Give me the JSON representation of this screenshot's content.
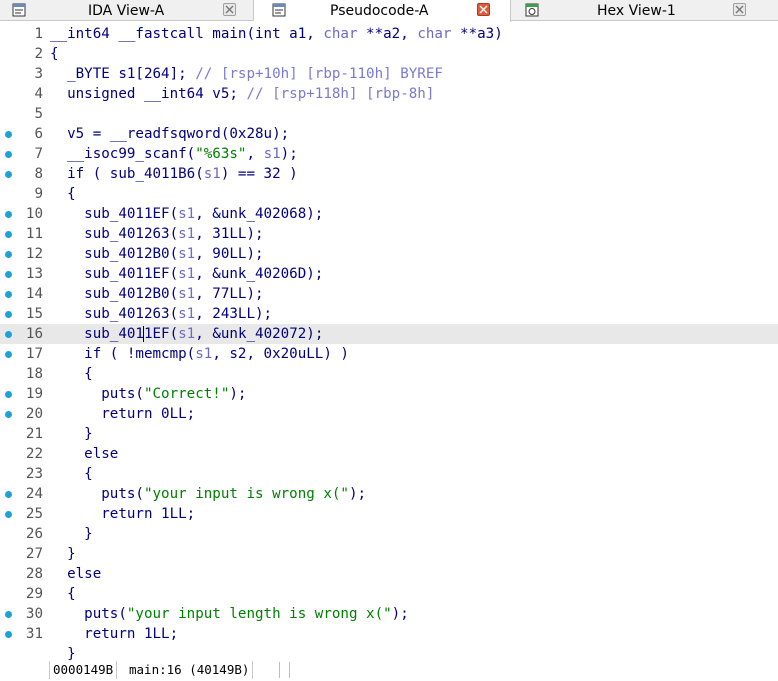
{
  "tabs": [
    {
      "label": "IDA View-A",
      "icon": "ida-view-icon",
      "active": false
    },
    {
      "label": "Pseudocode-A",
      "icon": "pseudocode-icon",
      "active": true
    },
    {
      "label": "Hex View-1",
      "icon": "hex-view-icon",
      "active": false
    }
  ],
  "code": {
    "lines": [
      {
        "n": "1",
        "bp": false,
        "t": [
          [
            "kw",
            "__int64 __fastcall main(int a1, "
          ],
          [
            "var",
            "char"
          ],
          [
            "kw",
            " **a2, "
          ],
          [
            "var",
            "char"
          ],
          [
            "kw",
            " **a3)"
          ]
        ]
      },
      {
        "n": "2",
        "bp": false,
        "t": [
          [
            "kw",
            "{"
          ]
        ]
      },
      {
        "n": "3",
        "bp": false,
        "t": [
          [
            "kw",
            "  _BYTE s1[264]; "
          ],
          [
            "cmt",
            "// [rsp+10h] [rbp-110h] BYREF"
          ]
        ]
      },
      {
        "n": "4",
        "bp": false,
        "t": [
          [
            "kw",
            "  unsigned __int64 v5; "
          ],
          [
            "cmt",
            "// [rsp+118h] [rbp-8h]"
          ]
        ]
      },
      {
        "n": "5",
        "bp": false,
        "t": [
          [
            "kw",
            ""
          ]
        ]
      },
      {
        "n": "6",
        "bp": true,
        "t": [
          [
            "kw",
            "  v5 = __readfsqword(0x28u);"
          ]
        ]
      },
      {
        "n": "7",
        "bp": true,
        "t": [
          [
            "kw",
            "  __isoc99_scanf("
          ],
          [
            "str",
            "\"%63s\""
          ],
          [
            "kw",
            ", "
          ],
          [
            "var",
            "s1"
          ],
          [
            "kw",
            ");"
          ]
        ]
      },
      {
        "n": "8",
        "bp": true,
        "t": [
          [
            "kw",
            "  if ( sub_4011B6("
          ],
          [
            "var",
            "s1"
          ],
          [
            "kw",
            ") == 32 )"
          ]
        ]
      },
      {
        "n": "9",
        "bp": false,
        "t": [
          [
            "kw",
            "  {"
          ]
        ]
      },
      {
        "n": "10",
        "bp": true,
        "t": [
          [
            "kw",
            "    sub_4011EF("
          ],
          [
            "var",
            "s1"
          ],
          [
            "kw",
            ", &unk_402068);"
          ]
        ]
      },
      {
        "n": "11",
        "bp": true,
        "t": [
          [
            "kw",
            "    sub_401263("
          ],
          [
            "var",
            "s1"
          ],
          [
            "kw",
            ", 31LL);"
          ]
        ]
      },
      {
        "n": "12",
        "bp": true,
        "t": [
          [
            "kw",
            "    sub_4012B0("
          ],
          [
            "var",
            "s1"
          ],
          [
            "kw",
            ", 90LL);"
          ]
        ]
      },
      {
        "n": "13",
        "bp": true,
        "t": [
          [
            "kw",
            "    sub_4011EF("
          ],
          [
            "var",
            "s1"
          ],
          [
            "kw",
            ", &unk_40206D);"
          ]
        ]
      },
      {
        "n": "14",
        "bp": true,
        "t": [
          [
            "kw",
            "    sub_4012B0("
          ],
          [
            "var",
            "s1"
          ],
          [
            "kw",
            ", 77LL);"
          ]
        ]
      },
      {
        "n": "15",
        "bp": true,
        "t": [
          [
            "kw",
            "    sub_401263("
          ],
          [
            "var",
            "s1"
          ],
          [
            "kw",
            ", 243LL);"
          ]
        ]
      },
      {
        "n": "16",
        "bp": true,
        "hl": true,
        "t": [
          [
            "kw",
            "    sub_401"
          ],
          [
            "cursor",
            ""
          ],
          [
            "kw",
            "1EF("
          ],
          [
            "var",
            "s1"
          ],
          [
            "kw",
            ", &unk_402072);"
          ]
        ]
      },
      {
        "n": "17",
        "bp": true,
        "t": [
          [
            "kw",
            "    if ( !memcmp("
          ],
          [
            "var",
            "s1"
          ],
          [
            "kw",
            ", s2, 0x20uLL) )"
          ]
        ]
      },
      {
        "n": "18",
        "bp": false,
        "t": [
          [
            "kw",
            "    {"
          ]
        ]
      },
      {
        "n": "19",
        "bp": true,
        "t": [
          [
            "kw",
            "      puts("
          ],
          [
            "str",
            "\"Correct!\""
          ],
          [
            "kw",
            ");"
          ]
        ]
      },
      {
        "n": "20",
        "bp": true,
        "t": [
          [
            "kw",
            "      return 0LL;"
          ]
        ]
      },
      {
        "n": "21",
        "bp": false,
        "t": [
          [
            "kw",
            "    }"
          ]
        ]
      },
      {
        "n": "22",
        "bp": false,
        "t": [
          [
            "kw",
            "    else"
          ]
        ]
      },
      {
        "n": "23",
        "bp": false,
        "t": [
          [
            "kw",
            "    {"
          ]
        ]
      },
      {
        "n": "24",
        "bp": true,
        "t": [
          [
            "kw",
            "      puts("
          ],
          [
            "str",
            "\"your input is wrong x(\""
          ],
          [
            "kw",
            ");"
          ]
        ]
      },
      {
        "n": "25",
        "bp": true,
        "t": [
          [
            "kw",
            "      return 1LL;"
          ]
        ]
      },
      {
        "n": "26",
        "bp": false,
        "t": [
          [
            "kw",
            "    }"
          ]
        ]
      },
      {
        "n": "27",
        "bp": false,
        "t": [
          [
            "kw",
            "  }"
          ]
        ]
      },
      {
        "n": "28",
        "bp": false,
        "t": [
          [
            "kw",
            "  else"
          ]
        ]
      },
      {
        "n": "29",
        "bp": false,
        "t": [
          [
            "kw",
            "  {"
          ]
        ]
      },
      {
        "n": "30",
        "bp": true,
        "t": [
          [
            "kw",
            "    puts("
          ],
          [
            "str",
            "\"your input length is wrong x(\""
          ],
          [
            "kw",
            ");"
          ]
        ]
      },
      {
        "n": "31",
        "bp": true,
        "t": [
          [
            "kw",
            "    return 1LL;"
          ]
        ]
      },
      {
        "n": "",
        "bp": false,
        "t": [
          [
            "kw",
            "  }"
          ]
        ]
      }
    ]
  },
  "status": {
    "address": "0000149B",
    "location": "main:16 (40149B)"
  },
  "colors": {
    "keyword": "#000080",
    "comment": "#7a7ad0",
    "string": "#008000",
    "variable": "#6a6ac8",
    "breakpoint_dot": "#1aa3d9",
    "highlight_line": "#e8e8e8"
  }
}
